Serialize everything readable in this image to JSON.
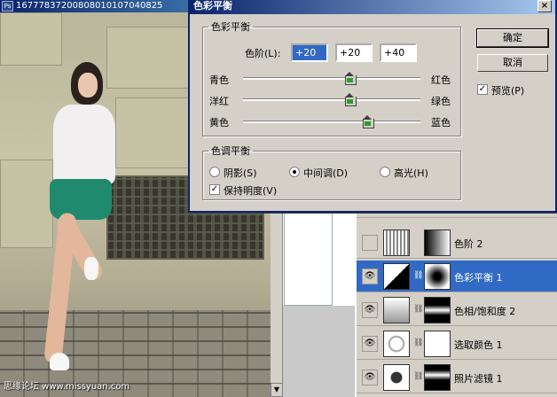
{
  "document": {
    "title": "16777837200808010107040825",
    "ps_icon": "Ps"
  },
  "watermark": "思缘论坛 www.missyuan.com",
  "dialog": {
    "title": "色彩平衡",
    "close_icon": "×",
    "balance_group_label": "色彩平衡",
    "levels_label": "色阶(L):",
    "levels": [
      "+20",
      "+20",
      "+40"
    ],
    "sliders": [
      {
        "left": "青色",
        "right": "红色",
        "value": 20
      },
      {
        "left": "洋红",
        "right": "绿色",
        "value": 20
      },
      {
        "left": "黄色",
        "right": "蓝色",
        "value": 40
      }
    ],
    "tone_group_label": "色调平衡",
    "tone_options": [
      {
        "label": "阴影(S)",
        "selected": false
      },
      {
        "label": "中间调(D)",
        "selected": true
      },
      {
        "label": "高光(H)",
        "selected": false
      }
    ],
    "preserve_luminosity": {
      "label": "保持明度(V)",
      "checked": true
    },
    "ok_label": "确定",
    "cancel_label": "取消",
    "preview": {
      "label": "预览(P)",
      "checked": true
    }
  },
  "layers": [
    {
      "name": "色阶 2",
      "visible": false,
      "selected": false
    },
    {
      "name": "色彩平衡 1",
      "visible": true,
      "selected": true
    },
    {
      "name": "色相/饱和度 2",
      "visible": true,
      "selected": false
    },
    {
      "name": "选取颜色 1",
      "visible": true,
      "selected": false
    },
    {
      "name": "照片滤镜 1",
      "visible": true,
      "selected": false
    }
  ],
  "icons": {
    "eye": "eye-icon",
    "link": "chain-link-icon",
    "check": "checkmark-icon"
  }
}
